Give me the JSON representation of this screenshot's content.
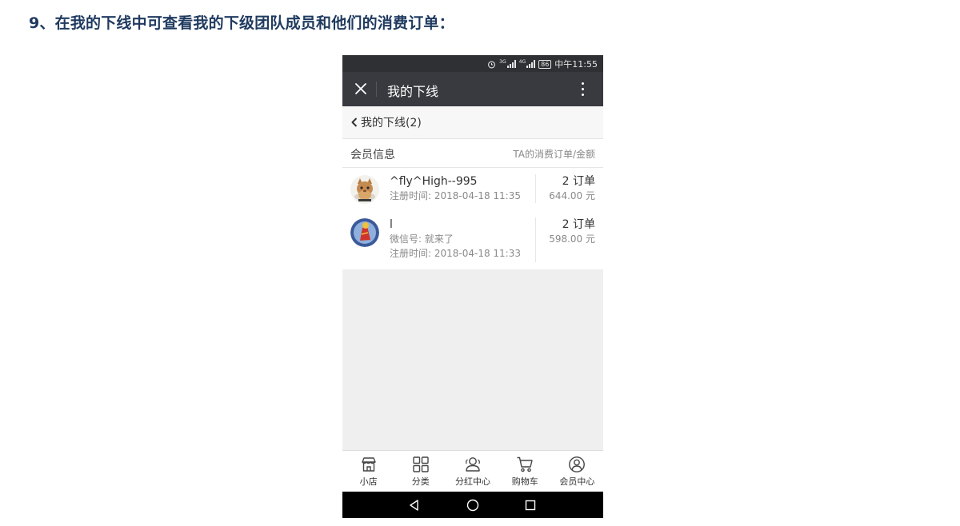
{
  "slide": {
    "title": "9、在我的下线中可查看我的下级团队成员和他们的消费订单："
  },
  "status_bar": {
    "time": "中午11:55",
    "battery": "86",
    "signal_1_label": "3G",
    "signal_2_label": "4G"
  },
  "title_bar": {
    "title": "我的下线",
    "close_icon": "close-icon",
    "more_icon": "more-vertical-icon"
  },
  "back_row": {
    "label": "我的下线(2)",
    "icon": "chevron-left-icon"
  },
  "list_header": {
    "left": "会员信息",
    "right": "TA的消费订单/金额"
  },
  "members": [
    {
      "name": "^fly^High--995",
      "register_time": "注册时间: 2018-04-18 11:35",
      "orders": "2 订单",
      "amount": "644.00 元",
      "avatar_icon": "cat-avatar-icon"
    },
    {
      "name": "l",
      "wechat": "微信号: 就来了",
      "register_time": "注册时间: 2018-04-18 11:33",
      "orders": "2 订单",
      "amount": "598.00 元",
      "avatar_icon": "red-figure-avatar-icon"
    }
  ],
  "tabbar": {
    "items": [
      {
        "label": "小店",
        "icon": "store-icon"
      },
      {
        "label": "分类",
        "icon": "grid-icon"
      },
      {
        "label": "分红中心",
        "icon": "users-icon"
      },
      {
        "label": "购物车",
        "icon": "cart-icon"
      },
      {
        "label": "会员中心",
        "icon": "user-circle-icon"
      }
    ]
  },
  "android_nav": {
    "back_icon": "triangle-back-icon",
    "home_icon": "circle-home-icon",
    "recents_icon": "square-recents-icon"
  },
  "colors": {
    "slide_title": "#1f3a5f",
    "title_bar_bg": "#393a3f",
    "status_bar_bg": "#2f3033",
    "page_bg": "#efefef"
  }
}
